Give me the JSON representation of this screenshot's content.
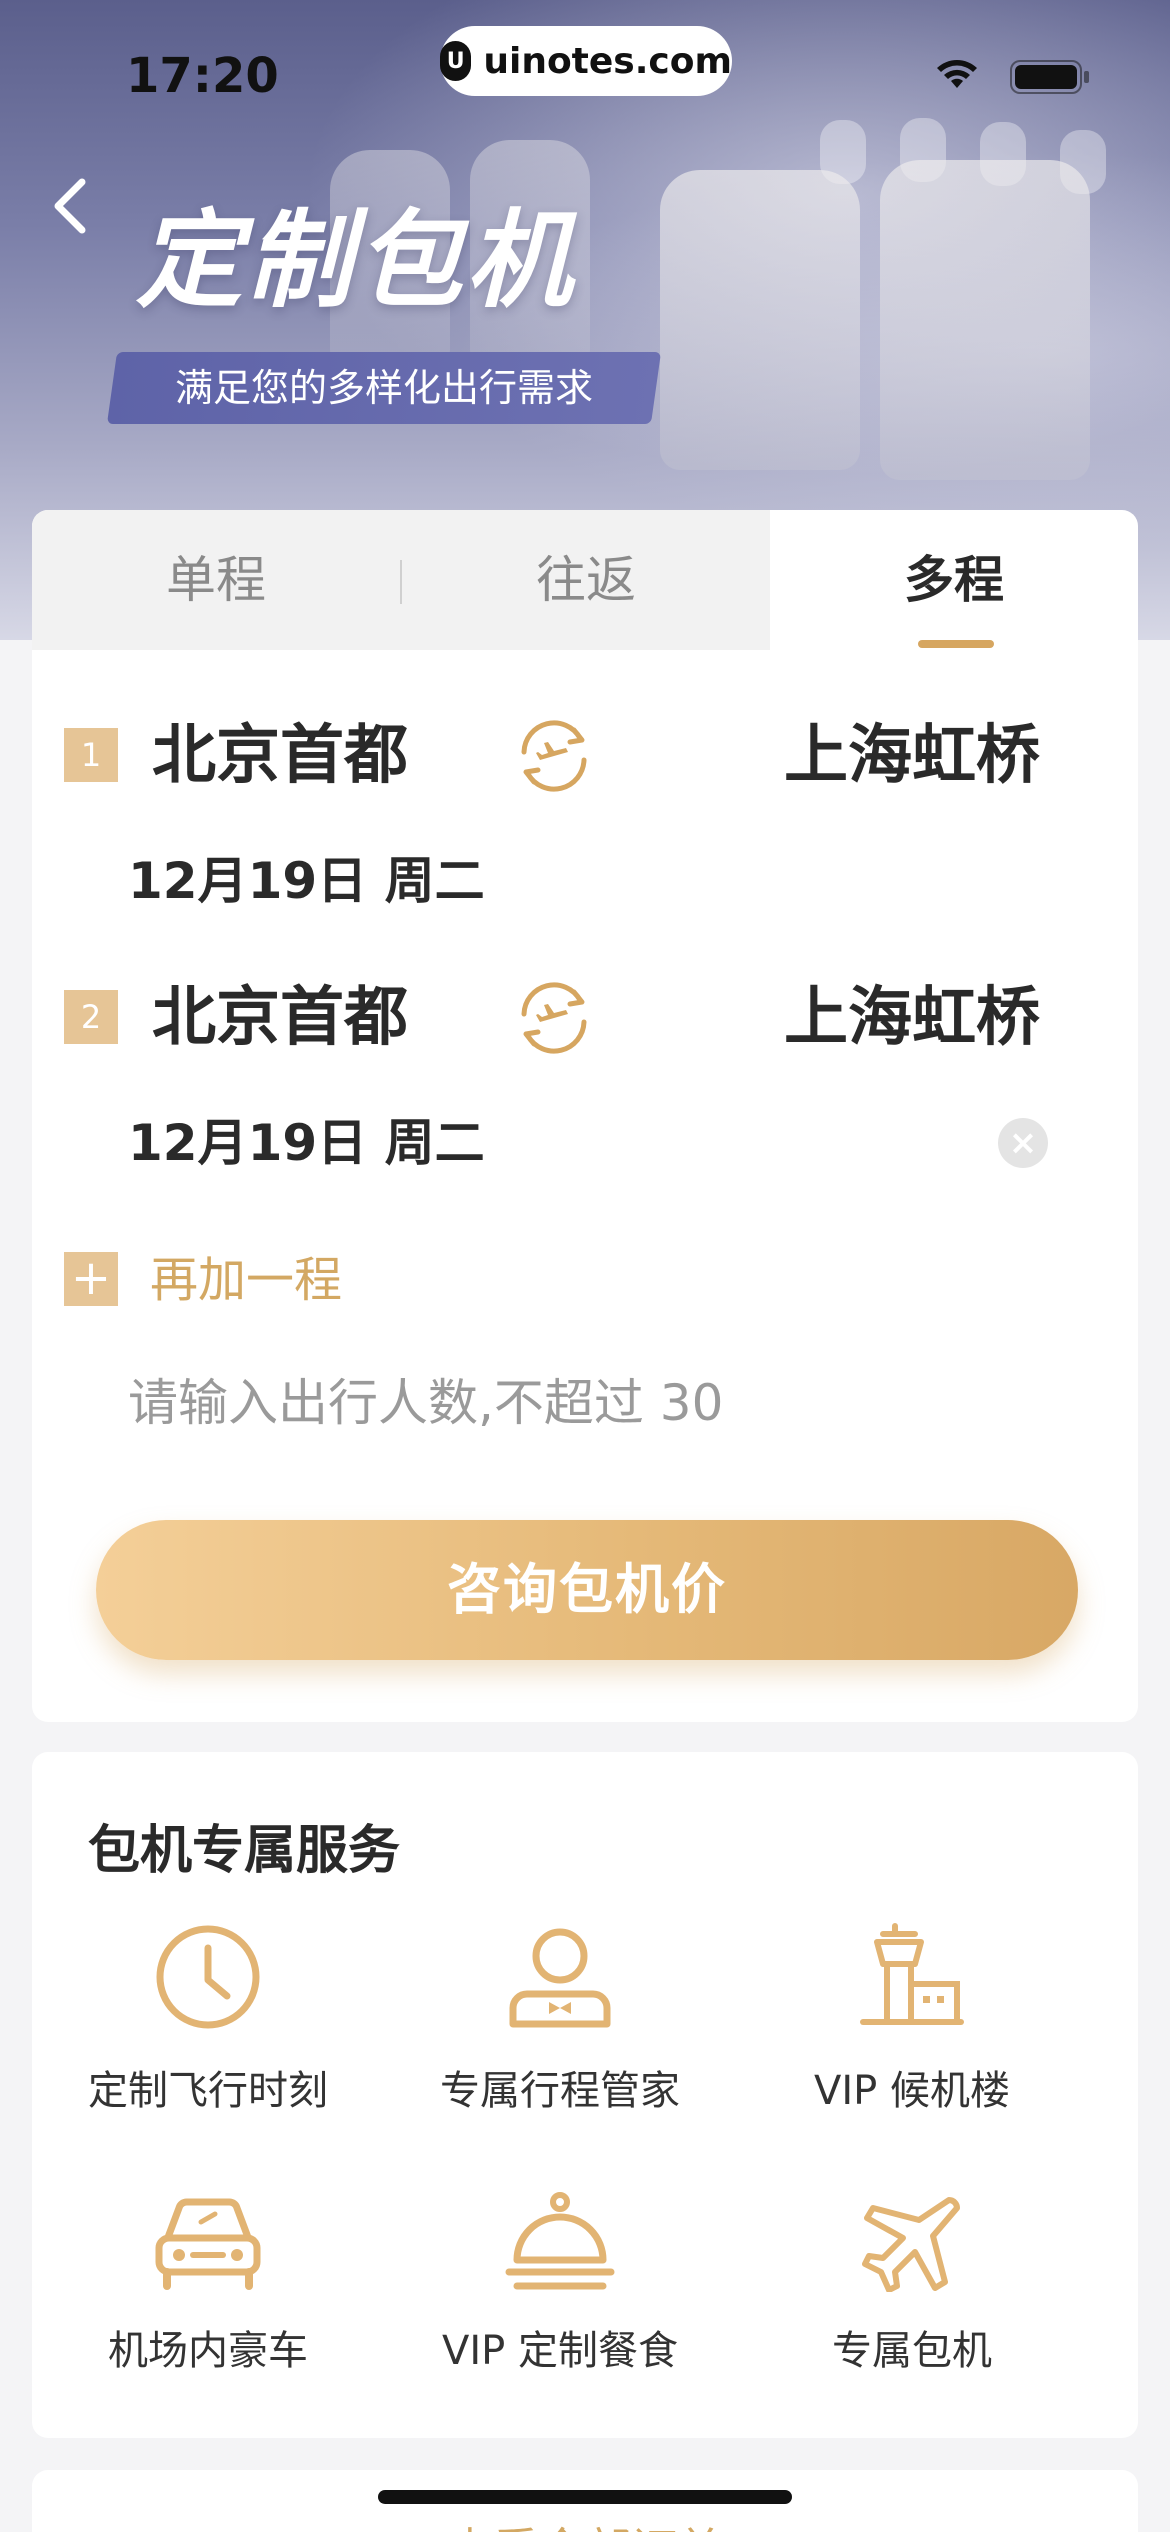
{
  "status_bar": {
    "time": "17:20",
    "url": "uinotes.com",
    "url_logo": "U"
  },
  "hero": {
    "title": "定制包机",
    "subtitle": "满足您的多样化出行需求",
    "back_icon": "chevron-left-icon"
  },
  "tabs": [
    {
      "label": "单程",
      "active": false
    },
    {
      "label": "往返",
      "active": false
    },
    {
      "label": "多程",
      "active": true
    }
  ],
  "legs": [
    {
      "number": "1",
      "from": "北京首都",
      "to": "上海虹桥",
      "date": "12月19日 周二",
      "removable": false
    },
    {
      "number": "2",
      "from": "北京首都",
      "to": "上海虹桥",
      "date": "12月19日 周二",
      "removable": true
    }
  ],
  "add_leg": {
    "icon": "+",
    "label": "再加一程"
  },
  "passenger_input": {
    "value": "",
    "placeholder": "请输入出行人数,不超过 30"
  },
  "cta": {
    "label": "咨询包机价"
  },
  "services": {
    "title": "包机专属服务",
    "items": [
      {
        "label": "定制飞行时刻",
        "icon": "clock-icon"
      },
      {
        "label": "专属行程管家",
        "icon": "butler-icon"
      },
      {
        "label": "VIP 候机楼",
        "icon": "control-tower-icon"
      },
      {
        "label": "机场内豪车",
        "icon": "car-icon"
      },
      {
        "label": "VIP 定制餐食",
        "icon": "food-cloche-icon"
      },
      {
        "label": "专属包机",
        "icon": "airplane-icon"
      }
    ]
  },
  "bottom_link": {
    "label": "查看全部订单"
  },
  "colors": {
    "accent_gold": "#d6a660",
    "gold_light": "#f4cf98",
    "badge_gold": "#e6c596",
    "hero_purple": "#5e63a8",
    "background": "#f4f4f6"
  }
}
